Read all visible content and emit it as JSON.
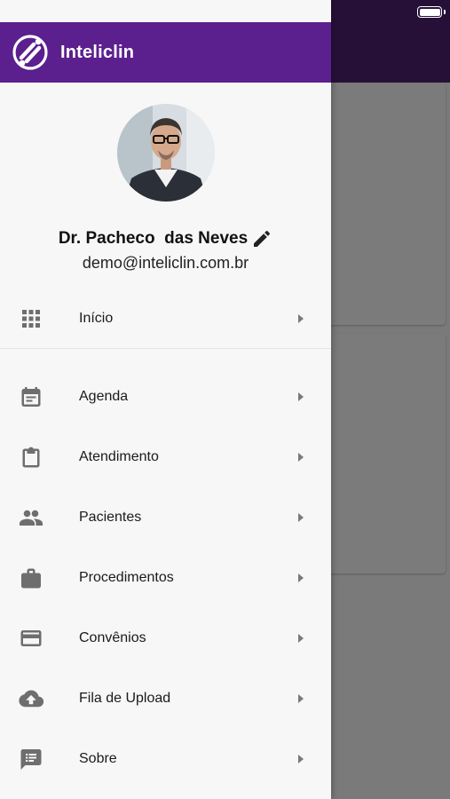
{
  "app": {
    "brand": "Inteliclin"
  },
  "profile": {
    "name": "Dr. Pacheco  das Neves",
    "email": "demo@inteliclin.com.br"
  },
  "menu": [
    {
      "label": "Início",
      "icon": "grid-icon"
    },
    {
      "label": "Agenda",
      "icon": "calendar-icon"
    },
    {
      "label": "Atendimento",
      "icon": "clipboard-icon"
    },
    {
      "label": "Pacientes",
      "icon": "people-icon"
    },
    {
      "label": "Procedimentos",
      "icon": "briefcase-icon"
    },
    {
      "label": "Convênios",
      "icon": "credit-card-icon"
    },
    {
      "label": "Fila de Upload",
      "icon": "cloud-upload-icon"
    },
    {
      "label": "Sobre",
      "icon": "feedback-icon"
    }
  ],
  "colors": {
    "brand": "#5c1f8e",
    "icons": "#6e6e6e"
  }
}
